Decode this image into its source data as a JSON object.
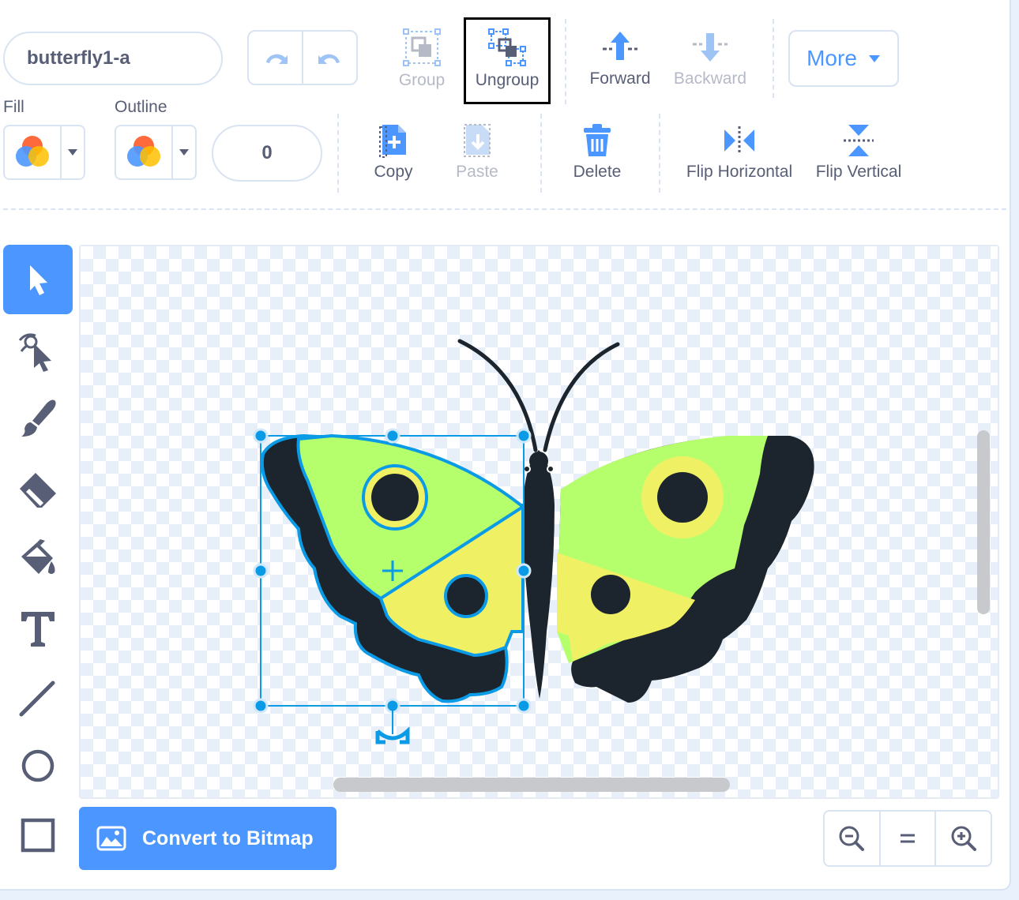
{
  "costume": {
    "name": "butterfly1-a"
  },
  "toolbar": {
    "group_label": "Group",
    "ungroup_label": "Ungroup",
    "forward_label": "Forward",
    "backward_label": "Backward",
    "more_label": "More",
    "copy_label": "Copy",
    "paste_label": "Paste",
    "delete_label": "Delete",
    "flip_h_label": "Flip Horizontal",
    "flip_v_label": "Flip Vertical"
  },
  "style": {
    "fill_label": "Fill",
    "outline_label": "Outline",
    "outline_width": "0"
  },
  "tools": [
    {
      "icon": "select-arrow-icon",
      "active": true
    },
    {
      "icon": "reshape-icon",
      "active": false
    },
    {
      "icon": "brush-icon",
      "active": false
    },
    {
      "icon": "eraser-icon",
      "active": false
    },
    {
      "icon": "fill-bucket-icon",
      "active": false
    },
    {
      "icon": "text-icon",
      "active": false
    },
    {
      "icon": "line-icon",
      "active": false
    },
    {
      "icon": "circle-icon",
      "active": false
    },
    {
      "icon": "rectangle-icon",
      "active": false
    }
  ],
  "bottom": {
    "convert_label": "Convert to Bitmap"
  },
  "zoom": {
    "zoom_out_icon": "zoom-out-icon",
    "reset_icon": "zoom-reset-icon",
    "zoom_in_icon": "zoom-in-icon"
  },
  "colors": {
    "accent": "#4c97ff",
    "selection": "#0b9be6",
    "wing_green": "#b5ff6c",
    "wing_yellow": "#f0f064",
    "body_dark": "#1c252d"
  }
}
